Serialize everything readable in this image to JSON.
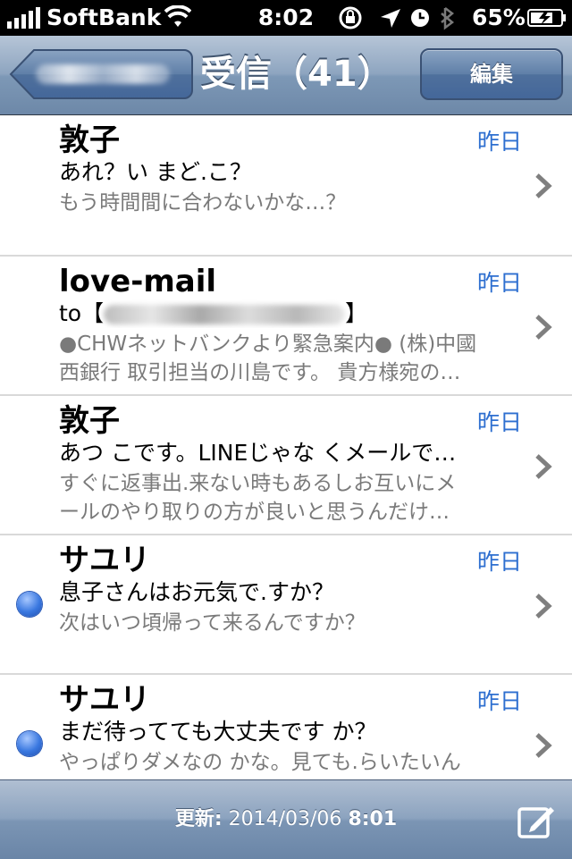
{
  "status_bar": {
    "carrier": "SoftBank",
    "time": "8:02",
    "battery_percent": "65%",
    "icons": [
      "signal-bars-icon",
      "wifi-icon",
      "rotation-lock-icon",
      "location-arrow-icon",
      "alarm-clock-icon",
      "bluetooth-icon",
      "battery-icon"
    ]
  },
  "nav": {
    "title": "受信（41）",
    "edit_label": "編集"
  },
  "messages": [
    {
      "sender": "敦子",
      "date": "昨日",
      "subject": "あれ？い まど.こ？",
      "preview": "もう時間間に合わないかな…？",
      "preview2": "",
      "unread": false
    },
    {
      "sender": "love-mail",
      "date": "昨日",
      "subject_prefix": "to【",
      "subject_suffix": "】",
      "preview": "●CHWネットバンクより緊急案内● (株)中國",
      "preview2": "西銀行 取引担当の川島です。 貴方様宛の…",
      "unread": false
    },
    {
      "sender": "敦子",
      "date": "昨日",
      "subject": "あつ こです。LINEじゃな くメールで…",
      "preview": "すぐに返事出.来ない時もあるしお互いにメ",
      "preview2": "ールのやり取りの方が良いと思うんだけ…",
      "unread": false
    },
    {
      "sender": "サユリ",
      "date": "昨日",
      "subject": "息子さんはお元気で.すか？",
      "preview": "次はいつ頃帰って来るんですか？",
      "preview2": "",
      "unread": true
    },
    {
      "sender": "サユリ",
      "date": "昨日",
      "subject": "まだ待ってても大丈夫です か？",
      "preview": "やっぱりダメなの かな。見ても.らいたいん",
      "preview2": "",
      "unread": true
    }
  ],
  "toolbar": {
    "updated_label": "更新:",
    "updated_date": "2014/03/06",
    "updated_time": "8:01"
  },
  "colors": {
    "accent_date": "#2e6fd0",
    "navbar": "#7d98b6",
    "unread_dot": "#3a78e0"
  }
}
